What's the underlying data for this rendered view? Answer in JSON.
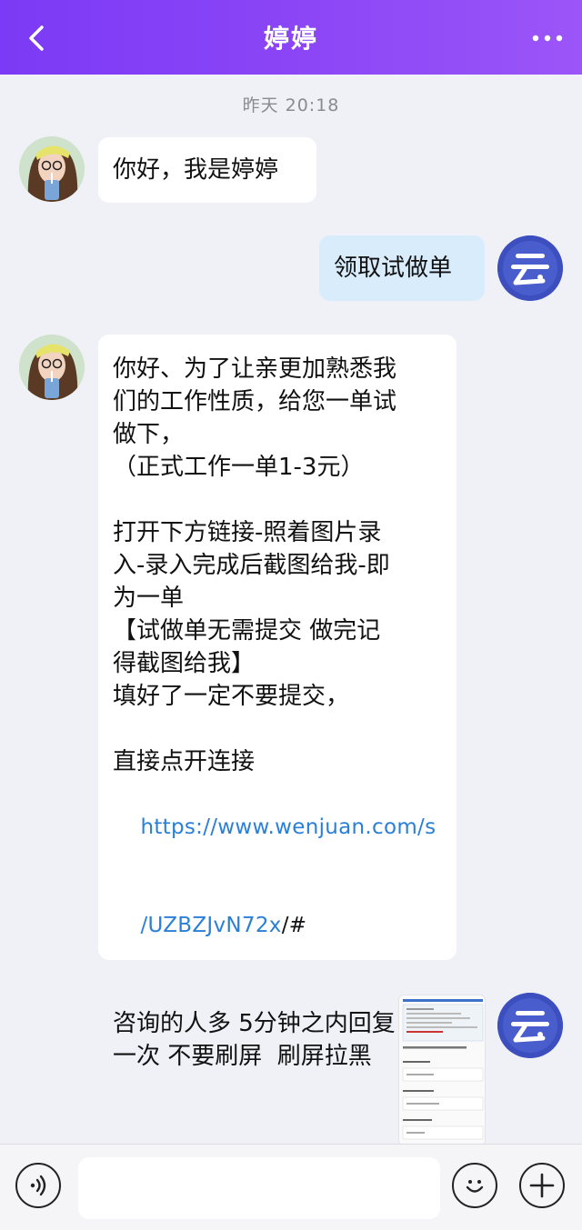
{
  "header": {
    "title": "婷婷",
    "back_icon": "chevron-left-icon",
    "more_icon": "more-dots-icon"
  },
  "timestamp": "昨天 20:18",
  "messages": [
    {
      "sender": "婷婷",
      "text": "你好，我是婷婷"
    },
    {
      "sender": "me",
      "text": "领取试做单"
    },
    {
      "sender": "婷婷",
      "lines": [
        "你好、为了让亲更加熟悉我",
        "们的工作性质，给您一单试",
        "做下，",
        "（正式工作一单1-3元）",
        "",
        "打开下方链接-照着图片录",
        "入-录入完成后截图给我-即",
        "为一单",
        "【试做单无需提交 做完记",
        "得截图给我】",
        "填好了一定不要提交，",
        "",
        "直接点开连接"
      ],
      "link_line1": "https://www.wenjuan.com/s",
      "link_line2": "/UZBZJvN72x",
      "link_suffix": "/#",
      "tail_lines": [
        "",
        "咨询的人多 5分钟之内回复",
        "一次 不要刷屏  刷屏拉黑"
      ]
    }
  ],
  "input_bar": {
    "voice_icon": "voice-icon",
    "emoji_icon": "emoji-icon",
    "plus_icon": "plus-icon",
    "placeholder": ""
  },
  "colors": {
    "header_gradient_start": "#7b3af5",
    "header_gradient_end": "#9b55f8",
    "my_bubble": "#d9ecfb",
    "link": "#2a7fd8",
    "avatar_yun_bg": "#3d4fbf"
  }
}
